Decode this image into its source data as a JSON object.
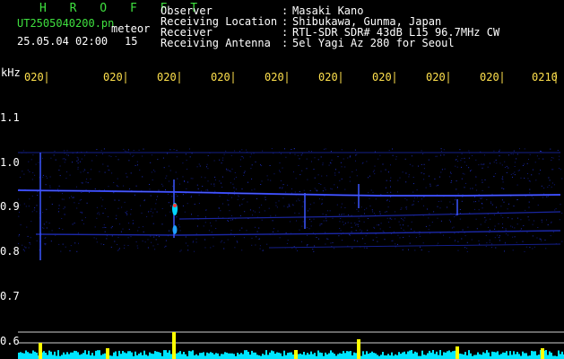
{
  "header": {
    "program": "H R O F F T",
    "filename": "UT2505040200.pn",
    "datetime": "25.05.04 02:00",
    "meteor_label": "meteor",
    "meteor_count": "15",
    "rows": [
      {
        "label": "Observer",
        "sep": ":",
        "value": "Masaki Kano"
      },
      {
        "label": "Receiving Location",
        "sep": ":",
        "value": "Shibukawa, Gunma, Japan"
      },
      {
        "label": "Receiver",
        "sep": ":",
        "value": "RTL-SDR SDR# 43dB L15 96.7MHz CW"
      },
      {
        "label": "Receiving Antenna",
        "sep": ":",
        "value": "5el Yagi Az 280 for Seoul"
      }
    ]
  },
  "axis": {
    "y_unit": "kHz",
    "y_ticks": [
      "1.1",
      "1.0",
      "0.9",
      "0.8",
      "0.7",
      "0.6"
    ],
    "x_ticks": [
      "020",
      "020",
      "020",
      "020",
      "020",
      "020",
      "020",
      "020",
      "020",
      "0210"
    ]
  },
  "colors": {
    "background": "#000000",
    "header_green": "#3fe03f",
    "header_white": "#ffffff",
    "tick_yellow": "#ffe14d",
    "signal_blue": "#2a3cff",
    "level_cyan": "#00e5ff",
    "level_yellow": "#ffff00"
  }
}
